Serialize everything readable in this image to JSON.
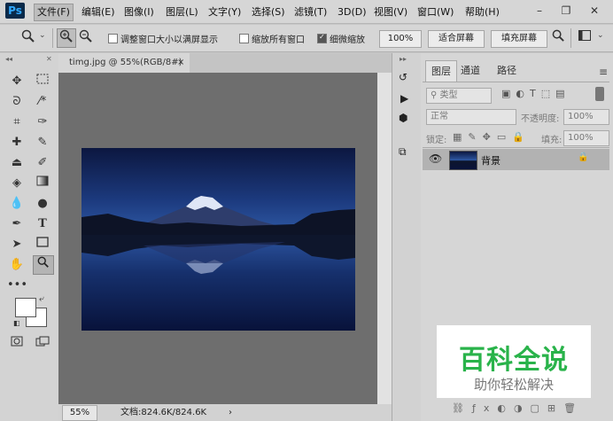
{
  "app": {
    "logo": "Ps"
  },
  "menu": [
    "文件(F)",
    "编辑(E)",
    "图像(I)",
    "图层(L)",
    "文字(Y)",
    "选择(S)",
    "滤镜(T)",
    "3D(D)",
    "视图(V)",
    "窗口(W)",
    "帮助(H)"
  ],
  "options": {
    "resize_windows": "调整窗口大小以满屏显示",
    "zoom_all_windows": "缩放所有窗口",
    "scrubby_zoom": "细微缩放",
    "zoom_value": "100%",
    "fit_screen": "适合屏幕",
    "fill_screen": "填充屏幕"
  },
  "document": {
    "tab_title": "timg.jpg @ 55%(RGB/8#)",
    "close_glyph": "×"
  },
  "status": {
    "zoom": "55%",
    "doc_info": "文档:824.6K/824.6K",
    "arrow": "›"
  },
  "panel": {
    "tabs": [
      "图层",
      "通道",
      "路径"
    ],
    "filter_kind": "类型",
    "blend_mode": "正常",
    "opacity_label": "不透明度:",
    "opacity_value": "100%",
    "lock_label": "锁定:",
    "fill_label": "填充:",
    "fill_value": "100%",
    "layer_name": "背景",
    "menu_glyph": "≡"
  },
  "watermark": {
    "title": "百科全说",
    "subtitle": "助你轻松解决",
    "title_color": "#29b34a"
  }
}
